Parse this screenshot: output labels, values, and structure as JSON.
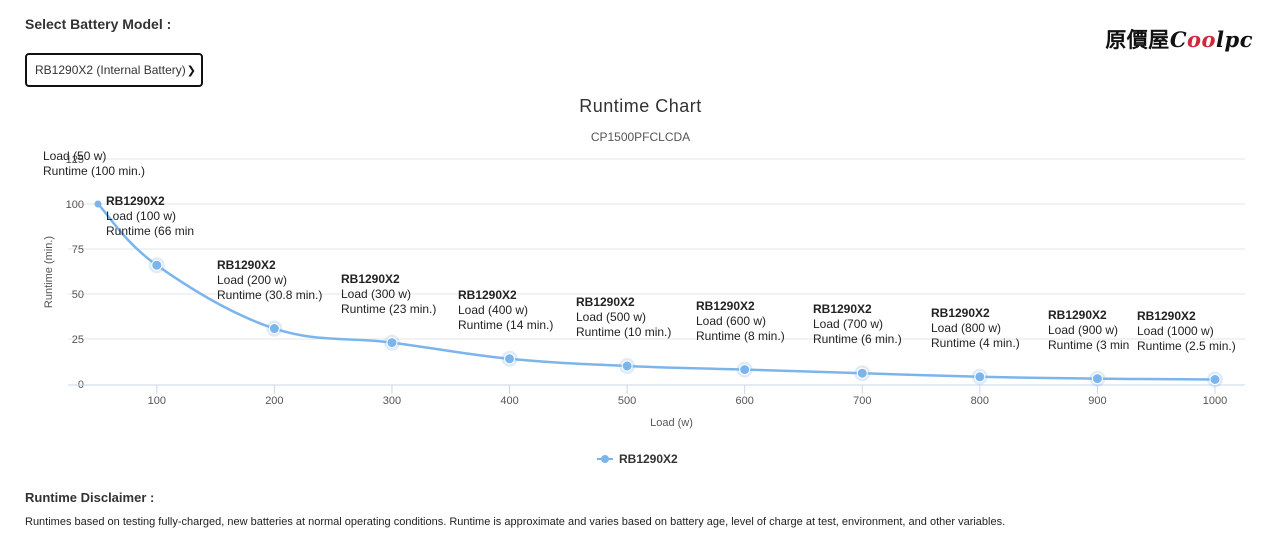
{
  "page": {
    "select_label": "Select Battery Model :",
    "select_value": "RB1290X2 (Internal Battery)",
    "logo_text": "原價屋",
    "logo_brand_a": "C",
    "logo_brand_oo": "oo",
    "logo_brand_b": "lpc",
    "disclaimer_title": "Runtime Disclaimer :",
    "disclaimer_text": "Runtimes based on testing fully-charged, new batteries at normal operating conditions. Runtime is approximate and varies based on battery age, level of charge at test, environment, and other variables."
  },
  "colors": {
    "series": "#7cb5ec",
    "grid": "#e6e6e6",
    "axis": "#ccd6eb"
  },
  "chart_data": {
    "type": "line",
    "title": "Runtime Chart",
    "subtitle": "CP1500PFCLCDA",
    "xlabel": "Load (w)",
    "ylabel": "Runtime (min.)",
    "xlim": [
      50,
      1000
    ],
    "ylim": [
      0,
      125
    ],
    "x_ticks": [
      100,
      200,
      300,
      400,
      500,
      600,
      700,
      800,
      900,
      1000
    ],
    "y_ticks": [
      0,
      25,
      50,
      75,
      100,
      125
    ],
    "grid": true,
    "legend": "bottom-center",
    "series": [
      {
        "name": "RB1290X2",
        "x": [
          50,
          100,
          200,
          300,
          400,
          500,
          600,
          700,
          800,
          900,
          1000
        ],
        "y": [
          100,
          66,
          30.8,
          23,
          14,
          10,
          8,
          6,
          4,
          3,
          2.5
        ]
      }
    ],
    "annotations": [
      {
        "series": "",
        "load": "Load (50 w)",
        "runtime": "Runtime (100 min.)"
      },
      {
        "series": "RB1290X2",
        "load": "Load (100 w)",
        "runtime": "Runtime (66 min"
      },
      {
        "series": "RB1290X2",
        "load": "Load (200 w)",
        "runtime": "Runtime (30.8 min.)"
      },
      {
        "series": "RB1290X2",
        "load": "Load (300 w)",
        "runtime": "Runtime (23 min.)"
      },
      {
        "series": "RB1290X2",
        "load": "Load (400 w)",
        "runtime": "Runtime (14 min.)"
      },
      {
        "series": "RB1290X2",
        "load": "Load (500 w)",
        "runtime": "Runtime (10 min.)"
      },
      {
        "series": "RB1290X2",
        "load": "Load (600 w)",
        "runtime": "Runtime (8 min.)"
      },
      {
        "series": "RB1290X2",
        "load": "Load (700 w)",
        "runtime": "Runtime (6 min.)"
      },
      {
        "series": "RB1290X2",
        "load": "Load (800 w)",
        "runtime": "Runtime (4 min.)"
      },
      {
        "series": "RB1290X2",
        "load": "Load (900 w)",
        "runtime": "Runtime (3 min"
      },
      {
        "series": "RB1290X2",
        "load": "Load (1000 w)",
        "runtime": "Runtime (2.5 min.)"
      }
    ]
  }
}
